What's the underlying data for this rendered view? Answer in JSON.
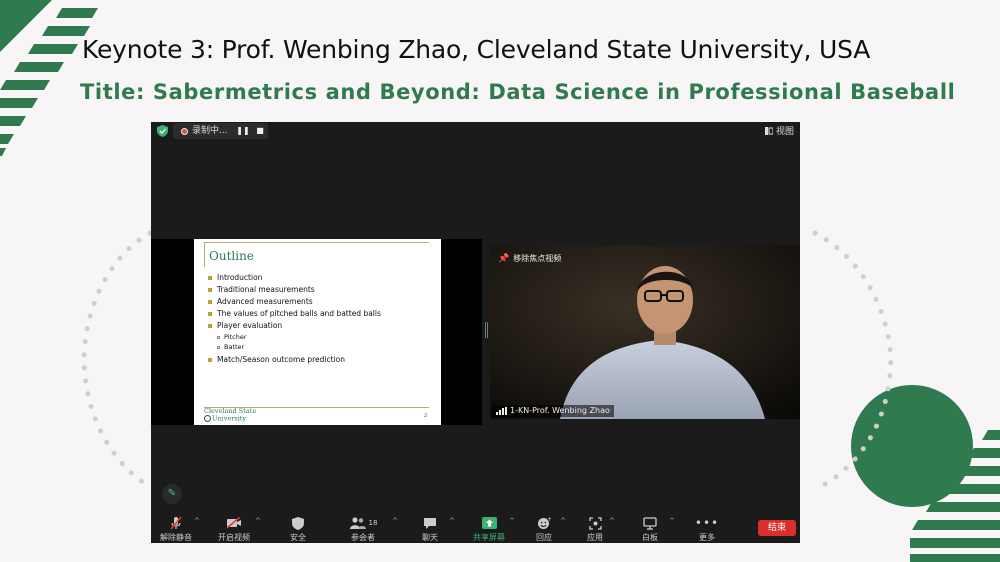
{
  "header": {
    "keynote": "Keynote 3: Prof. Wenbing Zhao, Cleveland State University, USA",
    "title": "Title: Sabermetrics and Beyond: Data Science in Professional Baseball"
  },
  "colors": {
    "brand_green": "#2f7a4e",
    "end_red": "#d9302f",
    "share_green": "#3cb371"
  },
  "zoom": {
    "recording_label": "录制中...",
    "view_label": "视图",
    "pin_label": "移除焦点视频",
    "speaker_name": "1-KN-Prof. Wenbing Zhao",
    "participants_count": "18",
    "end_label": "结束",
    "toolbar": {
      "unmute": "解除静音",
      "start_video": "开启视频",
      "security": "安全",
      "participants": "参会者",
      "chat": "聊天",
      "share_screen": "共享屏幕",
      "reactions": "回应",
      "apps": "应用",
      "whiteboard": "白板",
      "more": "更多"
    }
  },
  "slide": {
    "title": "Outline",
    "items": [
      {
        "text": "Introduction",
        "level": 1
      },
      {
        "text": "Traditional measurements",
        "level": 1
      },
      {
        "text": "Advanced measurements",
        "level": 1
      },
      {
        "text": "The values of pitched balls and batted balls",
        "level": 1
      },
      {
        "text": "Player evaluation",
        "level": 1
      },
      {
        "text": "Pitcher",
        "level": 2
      },
      {
        "text": "Batter",
        "level": 2
      },
      {
        "text": "Match/Season outcome prediction",
        "level": 1
      }
    ],
    "logo_line1": "Cleveland State",
    "logo_line2": "University",
    "page_number": "2"
  }
}
